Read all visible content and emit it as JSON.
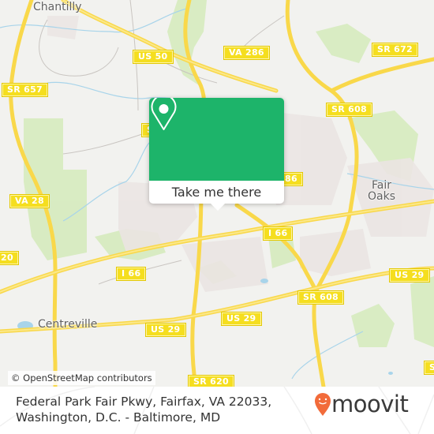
{
  "map": {
    "places": [
      {
        "id": "chantilly",
        "name": "Chantilly"
      },
      {
        "id": "fair-oaks",
        "name": "Fair\nOaks"
      },
      {
        "id": "centreville",
        "name": "Centreville"
      }
    ],
    "shields": [
      {
        "id": "us50",
        "label": "US 50"
      },
      {
        "id": "va286-top",
        "label": "VA 286"
      },
      {
        "id": "sr672",
        "label": "SR 672"
      },
      {
        "id": "sr657",
        "label": "SR 657"
      },
      {
        "id": "sr608-top",
        "label": "SR 608"
      },
      {
        "id": "sr-partial-left",
        "label": "S"
      },
      {
        "id": "va286-mid",
        "label": "86"
      },
      {
        "id": "va28",
        "label": "VA 28"
      },
      {
        "id": "sr620-left",
        "label": "20"
      },
      {
        "id": "i66-right",
        "label": "I 66"
      },
      {
        "id": "i66-left",
        "label": "I 66"
      },
      {
        "id": "us29-right",
        "label": "US 29"
      },
      {
        "id": "sr608-mid",
        "label": "SR 608"
      },
      {
        "id": "us29-mid",
        "label": "US 29"
      },
      {
        "id": "us29-left",
        "label": "US 29"
      },
      {
        "id": "sr620-bottom",
        "label": "SR 620"
      },
      {
        "id": "sr-partial-right",
        "label": "S"
      }
    ],
    "attribution": "© OpenStreetMap contributors"
  },
  "popup": {
    "icon": "map-pin-icon",
    "button_label": "Take me there",
    "color": "#1db46a"
  },
  "footer": {
    "address_line1": "Federal Park Fair Pkwy, Fairfax, VA 22033,",
    "address_line2": "Washington, D.C. - Baltimore, MD",
    "logo_text": "moovit",
    "logo_color": "#f26b3a"
  }
}
